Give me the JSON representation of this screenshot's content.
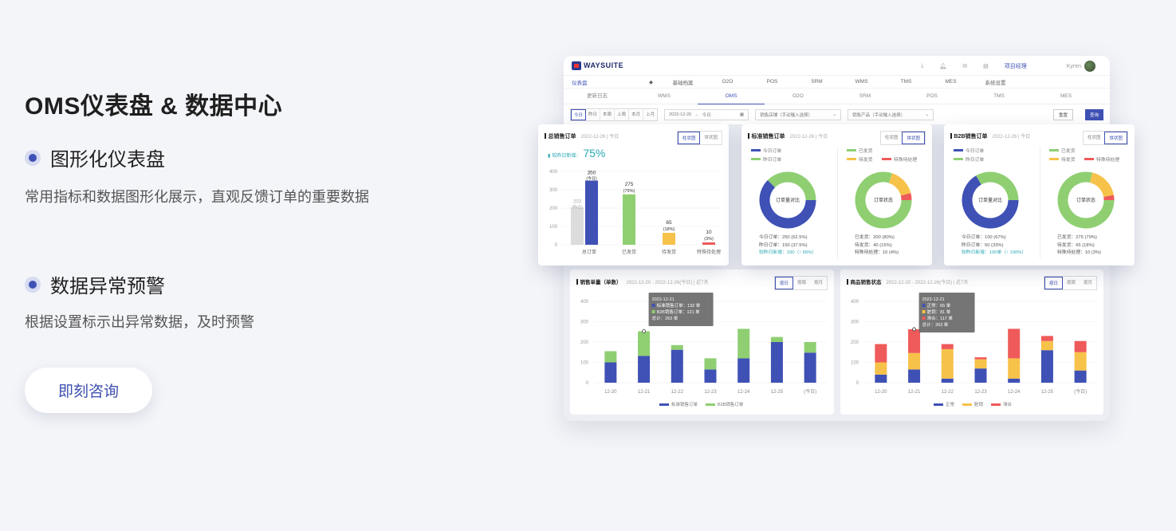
{
  "hero": {
    "title": "OMS仪表盘 & 数据中心",
    "features": [
      {
        "title": "图形化仪表盘",
        "desc": "常用指标和数据图形化展示，直观反馈订单的重要数据"
      },
      {
        "title": "数据异常预警",
        "desc": "根据设置标示出异常数据，及时预警"
      }
    ],
    "cta_label": "即刻咨询"
  },
  "dashboard": {
    "brand": "WAYSUITE",
    "top_link": "项目经理",
    "user": "Kyren",
    "nav": {
      "home": "仪表盘",
      "items": [
        "基础档案",
        "O2O",
        "POS",
        "SRM",
        "WMS",
        "TMS",
        "MES",
        "系统设置"
      ]
    },
    "subtabs": [
      "更新日志",
      "WMS",
      "OMS",
      "O2O",
      "SRM",
      "POS",
      "TMS",
      "MES"
    ],
    "active_subtab": "OMS",
    "filter": {
      "periods": [
        "今日",
        "昨日",
        "本周",
        "上周",
        "本月",
        "上月"
      ],
      "date_from": "2022-12-20",
      "arrow": "→",
      "date_to": "今日",
      "store_placeholder": "销售店铺（手动输入选择）",
      "product_placeholder": "销售产品（手动输入选择）",
      "reset": "重置",
      "query": "查询"
    },
    "total_orders": {
      "title": "总销售订单",
      "meta": "2022-12-26 | 今日",
      "toggle": [
        "柱状图",
        "饼状图"
      ],
      "growth_label": "较昨日新增：",
      "growth_value": "75%",
      "y_ticks": [
        "400",
        "300",
        "200",
        "100",
        "0"
      ],
      "bars": [
        {
          "label": "总订单",
          "value": 350,
          "sub": "(今日)",
          "prev": 203,
          "prev_sub": "(昨日)",
          "color": "#3f51b5"
        },
        {
          "label": "已发货",
          "value": 275,
          "sub": "(79%)",
          "color": "#8fcf72"
        },
        {
          "label": "待发货",
          "value": 65,
          "sub": "(18%)",
          "color": "#f7c24a"
        },
        {
          "label": "特殊待处理",
          "value": 10,
          "sub": "(3%)",
          "color": "#ef5a5a"
        }
      ]
    },
    "std_orders": {
      "title": "标准销售订单",
      "meta": "2022-12-26 | 今日",
      "toggle": [
        "柱状图",
        "饼状图"
      ],
      "legend_left": [
        "今日订单",
        "昨日订单"
      ],
      "legend_right": [
        "已发货",
        "待发货",
        "特殊待处理"
      ],
      "donut_left_label": "订单量对比",
      "donut_right_label": "订单状态",
      "donut_left": [
        250,
        150
      ],
      "donut_right": [
        200,
        40,
        10
      ],
      "stats_left": [
        "今日订单：250 (62.5%)",
        "昨日订单：150 (37.5%)",
        "较昨日新增：100（↑ 66%）"
      ],
      "stats_right": [
        "已发货：200 (80%)",
        "待发货：40 (16%)",
        "特殊待处理：10 (4%)"
      ]
    },
    "b2b_orders": {
      "title": "B2B销售订单",
      "meta": "2022-12-26 | 今日",
      "toggle": [
        "柱状图",
        "饼状图"
      ],
      "legend_left": [
        "今日订单",
        "昨日订单"
      ],
      "legend_right": [
        "已发货",
        "待发货",
        "特殊待处理"
      ],
      "donut_left_label": "订单量对比",
      "donut_right_label": "订单状态",
      "donut_left": [
        100,
        50
      ],
      "donut_right": [
        275,
        65,
        10
      ],
      "stats_left": [
        "今日订单：100 (67%)",
        "昨日订单：50 (33%)",
        "较昨日新增：100单（↑ 100%）"
      ],
      "stats_right": [
        "已发货：275 (79%)",
        "待发货：65 (18%)",
        "特殊待处理：10 (3%)"
      ]
    },
    "sales_volume": {
      "title": "销售单量（单数）",
      "meta": "2022-12-20 - 2022-12-26(今日) | 近7天",
      "toggle": [
        "按日",
        "按周",
        "按月"
      ],
      "y_ticks": [
        "400",
        "300",
        "200",
        "100",
        "0"
      ],
      "x": [
        "12-20",
        "12-21",
        "12-22",
        "12-23",
        "12-24",
        "12-25",
        "(今日)"
      ],
      "legend": [
        "标准销售订单",
        "B2B销售订单"
      ],
      "tooltip": [
        "2022-12-21",
        "标准销售订单：132 单",
        "B2B销售订单：121 单",
        "总计：263 单"
      ]
    },
    "product_status": {
      "title": "商品销售状态",
      "meta": "2022-12-20 - 2022-12-26(今日) | 近7天",
      "toggle": [
        "按日",
        "按周",
        "按月"
      ],
      "y_ticks": [
        "400",
        "300",
        "200",
        "100",
        "0"
      ],
      "x": [
        "12-20",
        "12-21",
        "12-22",
        "12-23",
        "12-24",
        "12-25",
        "(今日)"
      ],
      "legend": [
        "正常",
        "脏销",
        "滞合"
      ],
      "tooltip": [
        "2022-12-21",
        "正常：65 单",
        "脏销：81 单",
        "滞合：117 单",
        "总计：263 单"
      ]
    }
  },
  "chart_data": [
    {
      "type": "bar",
      "title": "总销售订单",
      "categories": [
        "总订单",
        "已发货",
        "待发货",
        "特殊待处理"
      ],
      "values": [
        350,
        275,
        65,
        10
      ],
      "ylim": [
        0,
        400
      ]
    },
    {
      "type": "bar",
      "title": "销售单量（单数）",
      "categories": [
        "12-20",
        "12-21",
        "12-22",
        "12-23",
        "12-24",
        "12-25",
        "(今日)"
      ],
      "series": [
        {
          "name": "标准销售订单",
          "values": [
            100,
            132,
            162,
            65,
            120,
            200,
            148
          ]
        },
        {
          "name": "B2B销售订单",
          "values": [
            55,
            121,
            23,
            55,
            145,
            25,
            52
          ]
        }
      ],
      "ylim": [
        0,
        400
      ]
    },
    {
      "type": "bar",
      "title": "商品销售状态",
      "categories": [
        "12-20",
        "12-21",
        "12-22",
        "12-23",
        "12-24",
        "12-25",
        "(今日)"
      ],
      "series": [
        {
          "name": "正常",
          "values": [
            40,
            65,
            20,
            70,
            20,
            160,
            60
          ]
        },
        {
          "name": "脏销",
          "values": [
            60,
            81,
            145,
            45,
            100,
            45,
            90
          ]
        },
        {
          "name": "滞合",
          "values": [
            90,
            117,
            25,
            10,
            145,
            25,
            55
          ]
        }
      ],
      "ylim": [
        0,
        400
      ]
    }
  ]
}
